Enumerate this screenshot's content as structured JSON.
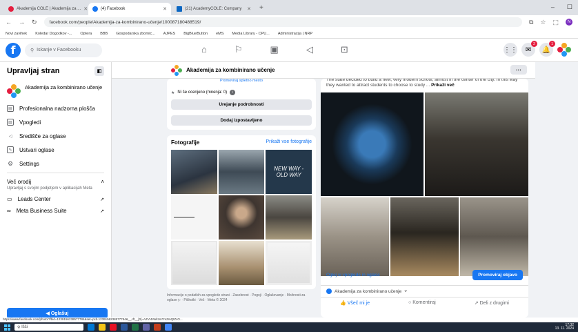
{
  "browser": {
    "tabs": [
      {
        "label": "Akademija COLE | Akademija za ...",
        "color": "#e41e3f",
        "active": false
      },
      {
        "label": "(4) Facebook",
        "color": "#1877f2",
        "active": true
      },
      {
        "label": "(21) AcademyCOLE: Company",
        "color": "#0a66c2",
        "active": false
      }
    ],
    "url": "facebook.com/people/Akademija-za-kombinirano-učenje/100087180488519/",
    "bookmarks": [
      "Novi zavihek",
      "Koledar Dogodkov -...",
      "Optera",
      "BBB",
      "Gospodarska zbornic...",
      "AJPES",
      "BigBlueButton",
      "eMS",
      "Media Library - CPU...",
      "Administracija | NRP"
    ],
    "profile_letter": "N"
  },
  "facebook": {
    "search_placeholder": "Iskanje v Facebooku",
    "notifications_badge": "1",
    "messages_badge": "2"
  },
  "sidebar": {
    "title": "Upravljaj stran",
    "page_name": "Akademija za kombinirano učenje",
    "items": [
      {
        "label": "Profesionalna nadzorna plošča"
      },
      {
        "label": "Vpogledi"
      },
      {
        "label": "Središče za oglase"
      },
      {
        "label": "Ustvari oglase"
      },
      {
        "label": "Settings"
      }
    ],
    "more_title": "Več orodij",
    "more_sub": "Upravljaj s svojim podjetjem v aplikacijah Meta",
    "tools": [
      {
        "label": "Leads Center"
      },
      {
        "label": "Meta Business Suite"
      }
    ],
    "promote_label": "Oglašuj"
  },
  "page_header": {
    "name": "Akademija za kombinirano učenje",
    "more": "···"
  },
  "about": {
    "partial": "Promoviraj spletno mesto",
    "rating": "Ni še ocenjeno (mnenja: 0)",
    "edit_details": "Urejanje podrobnosti",
    "add_featured": "Dodaj izpostavljeno"
  },
  "photos": {
    "title": "Fotografije",
    "show_all": "Prikaži vse fotografije",
    "tile_text": "NEW WAY - OLD WAY",
    "footer": "Informacije o podatkih za vpoglede strani · Zasebnost · Pogoji · Oglaševanje · Možnosti za oglase ▷ · Piškotki · Več · Meta © 2024"
  },
  "post": {
    "text": "The state decided to build a new, very modern school, almost in the center of the city. In this way they wanted to attract students to choose to study ...",
    "see_more": "Prikaži več",
    "insights_link": "Oglej si vpoglede in oglase",
    "promote_post": "Promoviraj objavo",
    "posting_as": "Akademija za kombinirano učenje",
    "like": "Všeč mi je",
    "comment": "Komentiraj",
    "share": "Deli z drugimi"
  },
  "status_url": "https://www.facebook.com/photo/?fbid=1239156238577784&set=pcb.1239156238577784&__cft__[0]=AZVr4rWkzmTmZmQtZxO...",
  "taskbar": {
    "search": "Išči",
    "time": "17:32",
    "date": "13. 11. 2024"
  }
}
